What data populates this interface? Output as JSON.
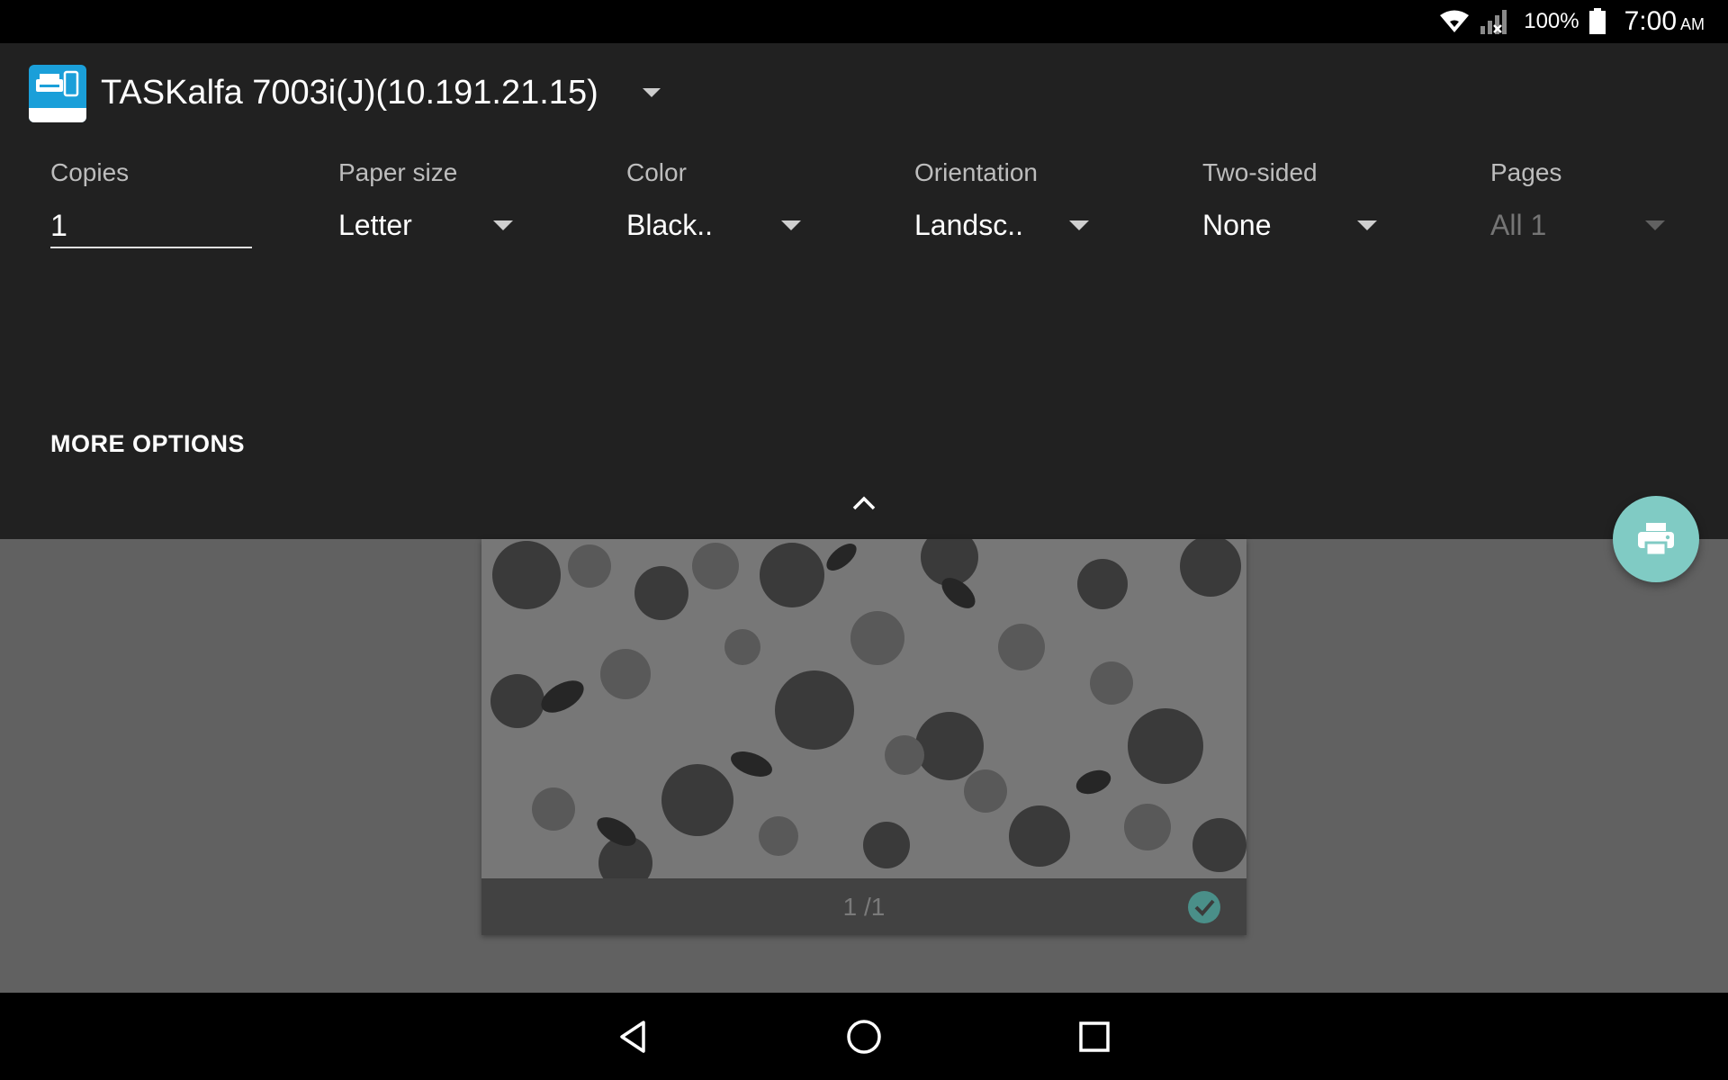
{
  "status_bar": {
    "battery_percent": "100%",
    "time": "7:00",
    "ampm": "AM",
    "icons": [
      "wifi-icon",
      "cell-signal-icon",
      "battery-icon"
    ]
  },
  "print_panel": {
    "printer_name": "TASKalfa 7003i(J)(10.191.21.15)",
    "app_icon": "kyocera-print-app-icon",
    "options": {
      "copies": {
        "label": "Copies",
        "value": "1"
      },
      "paper_size": {
        "label": "Paper size",
        "value": "Letter"
      },
      "color": {
        "label": "Color",
        "value": "Black.."
      },
      "orientation": {
        "label": "Orientation",
        "value": "Landsc.."
      },
      "two_sided": {
        "label": "Two-sided",
        "value": "None"
      },
      "pages": {
        "label": "Pages",
        "value": "All 1",
        "disabled": true
      }
    },
    "more_options_label": "MORE OPTIONS"
  },
  "preview": {
    "page_number": "1 /1",
    "selected": true
  },
  "fab": {
    "icon": "print-icon"
  },
  "nav_bar": {
    "icons": [
      "back-icon",
      "home-icon",
      "recents-icon"
    ]
  },
  "colors": {
    "panel_bg": "#212121",
    "preview_bg": "#616161",
    "fab_bg": "#80cbc4",
    "status_bg": "#000000"
  }
}
